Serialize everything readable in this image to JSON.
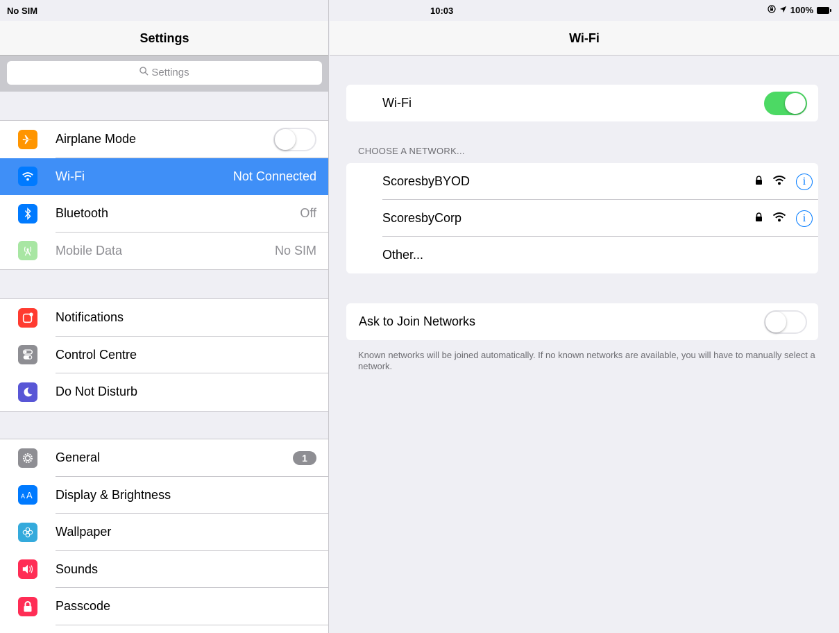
{
  "status_bar": {
    "carrier": "No SIM",
    "time": "10:03",
    "battery": "100%"
  },
  "master": {
    "title": "Settings",
    "search_placeholder": "Settings",
    "group1": [
      {
        "label": "Airplane Mode",
        "icon": "airplane-icon",
        "color": "#ff9500",
        "control": "toggle-off"
      },
      {
        "label": "Wi-Fi",
        "value": "Not Connected",
        "icon": "wifi-icon",
        "color": "#007aff",
        "selected": true
      },
      {
        "label": "Bluetooth",
        "value": "Off",
        "icon": "bluetooth-icon",
        "color": "#007aff"
      },
      {
        "label": "Mobile Data",
        "value": "No SIM",
        "icon": "antenna-icon",
        "color": "#a8e6a3",
        "dimmed": true
      }
    ],
    "group2": [
      {
        "label": "Notifications",
        "icon": "notifications-icon",
        "color": "#ff3b30"
      },
      {
        "label": "Control Centre",
        "icon": "control-centre-icon",
        "color": "#8e8e93"
      },
      {
        "label": "Do Not Disturb",
        "icon": "moon-icon",
        "color": "#5856d6"
      }
    ],
    "group3": [
      {
        "label": "General",
        "badge": "1",
        "icon": "gear-icon",
        "color": "#8e8e93"
      },
      {
        "label": "Display & Brightness",
        "icon": "text-size-icon",
        "color": "#007aff"
      },
      {
        "label": "Wallpaper",
        "icon": "flower-icon",
        "color": "#34aadc"
      },
      {
        "label": "Sounds",
        "icon": "speaker-icon",
        "color": "#ff2d55"
      },
      {
        "label": "Passcode",
        "icon": "lock-icon",
        "color": "#ff2d55"
      }
    ]
  },
  "detail": {
    "title": "Wi-Fi",
    "wifi_label": "Wi-Fi",
    "wifi_on": true,
    "choose_network_label": "CHOOSE A NETWORK...",
    "networks": [
      {
        "name": "ScoresbyBYOD",
        "secured": true
      },
      {
        "name": "ScoresbyCorp",
        "secured": true
      }
    ],
    "other_label": "Other...",
    "ask_to_join_label": "Ask to Join Networks",
    "ask_to_join_on": false,
    "footnote": "Known networks will be joined automatically. If no known networks are available, you will have to manually select a network."
  }
}
